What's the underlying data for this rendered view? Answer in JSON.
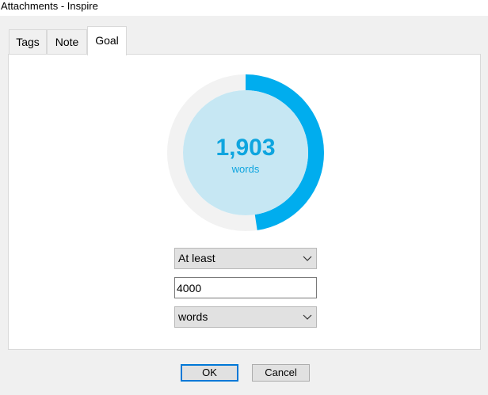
{
  "window": {
    "title": "Attachments - Inspire"
  },
  "tabs": [
    {
      "label": "Tags"
    },
    {
      "label": "Note"
    },
    {
      "label": "Goal"
    }
  ],
  "goal": {
    "current_count": "1,903",
    "unit_label": "words",
    "progress_fraction": 0.476,
    "mode": {
      "selected": "At least"
    },
    "target_value": "4000",
    "unit": {
      "selected": "words"
    }
  },
  "buttons": {
    "ok_label": "OK",
    "cancel_label": "Cancel"
  },
  "colors": {
    "accent": "#00adee",
    "ring_track": "#f2f2f2",
    "inner_circle": "#c6e7f3",
    "count_text": "#0ea5df"
  },
  "icons": {
    "dropdown": "chevron-down-icon"
  }
}
